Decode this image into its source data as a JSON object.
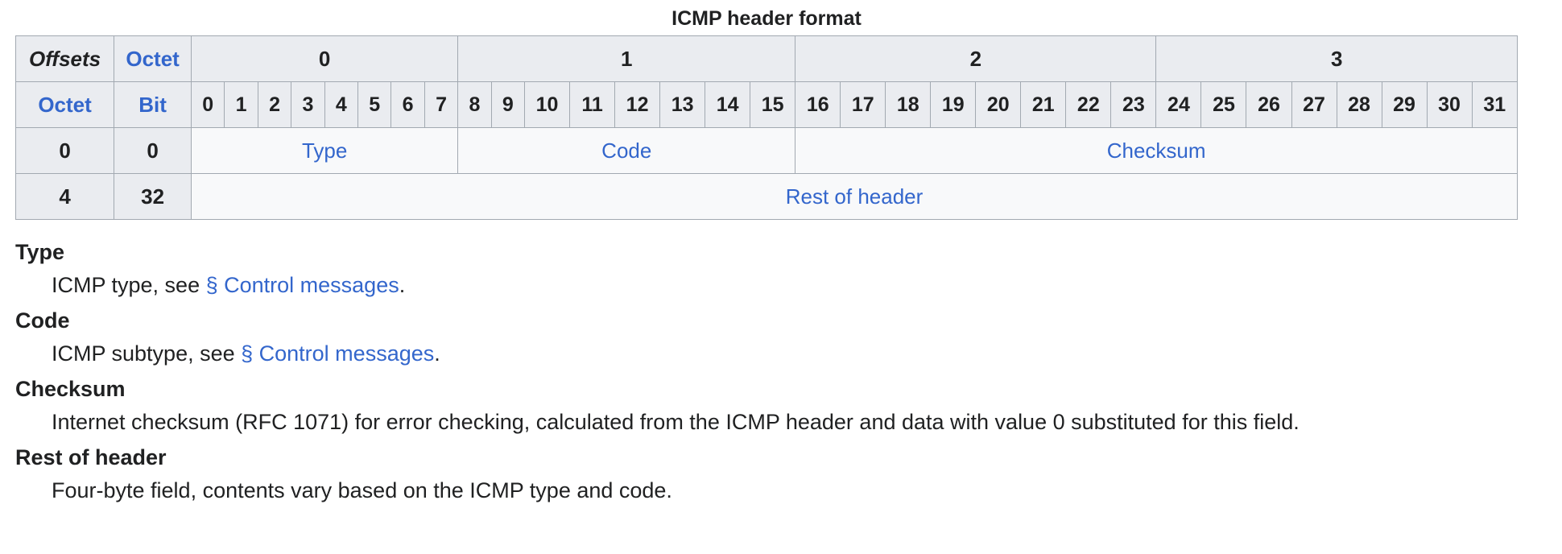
{
  "table": {
    "caption": "ICMP header format",
    "corner_offsets": "Offsets",
    "corner_octet": "Octet",
    "row_octet": "Octet",
    "row_bit": "Bit",
    "octets": [
      "0",
      "1",
      "2",
      "3"
    ],
    "bits": [
      "0",
      "1",
      "2",
      "3",
      "4",
      "5",
      "6",
      "7",
      "8",
      "9",
      "10",
      "11",
      "12",
      "13",
      "14",
      "15",
      "16",
      "17",
      "18",
      "19",
      "20",
      "21",
      "22",
      "23",
      "24",
      "25",
      "26",
      "27",
      "28",
      "29",
      "30",
      "31"
    ],
    "rows": [
      {
        "octet": "0",
        "bit": "0",
        "fields": [
          {
            "label": "Type",
            "bits": 8
          },
          {
            "label": "Code",
            "bits": 8
          },
          {
            "label": "Checksum",
            "bits": 16
          }
        ]
      },
      {
        "octet": "4",
        "bit": "32",
        "fields": [
          {
            "label": "Rest of header",
            "bits": 32
          }
        ]
      }
    ]
  },
  "definitions": [
    {
      "term": "Type",
      "text_before": "ICMP type, see ",
      "link": "§ Control messages",
      "text_after": "."
    },
    {
      "term": "Code",
      "text_before": "ICMP subtype, see ",
      "link": "§ Control messages",
      "text_after": "."
    },
    {
      "term": "Checksum",
      "text_before": "Internet checksum (RFC 1071) for error checking, calculated from the ICMP header and data with value 0 substituted for this field.",
      "link": "",
      "text_after": ""
    },
    {
      "term": "Rest of header",
      "text_before": "Four-byte field, contents vary based on the ICMP type and code.",
      "link": "",
      "text_after": ""
    }
  ],
  "colors": {
    "link": "#3366cc",
    "header_bg": "#eaecf0",
    "cell_bg": "#f8f9fa",
    "border": "#a2a9b1"
  }
}
